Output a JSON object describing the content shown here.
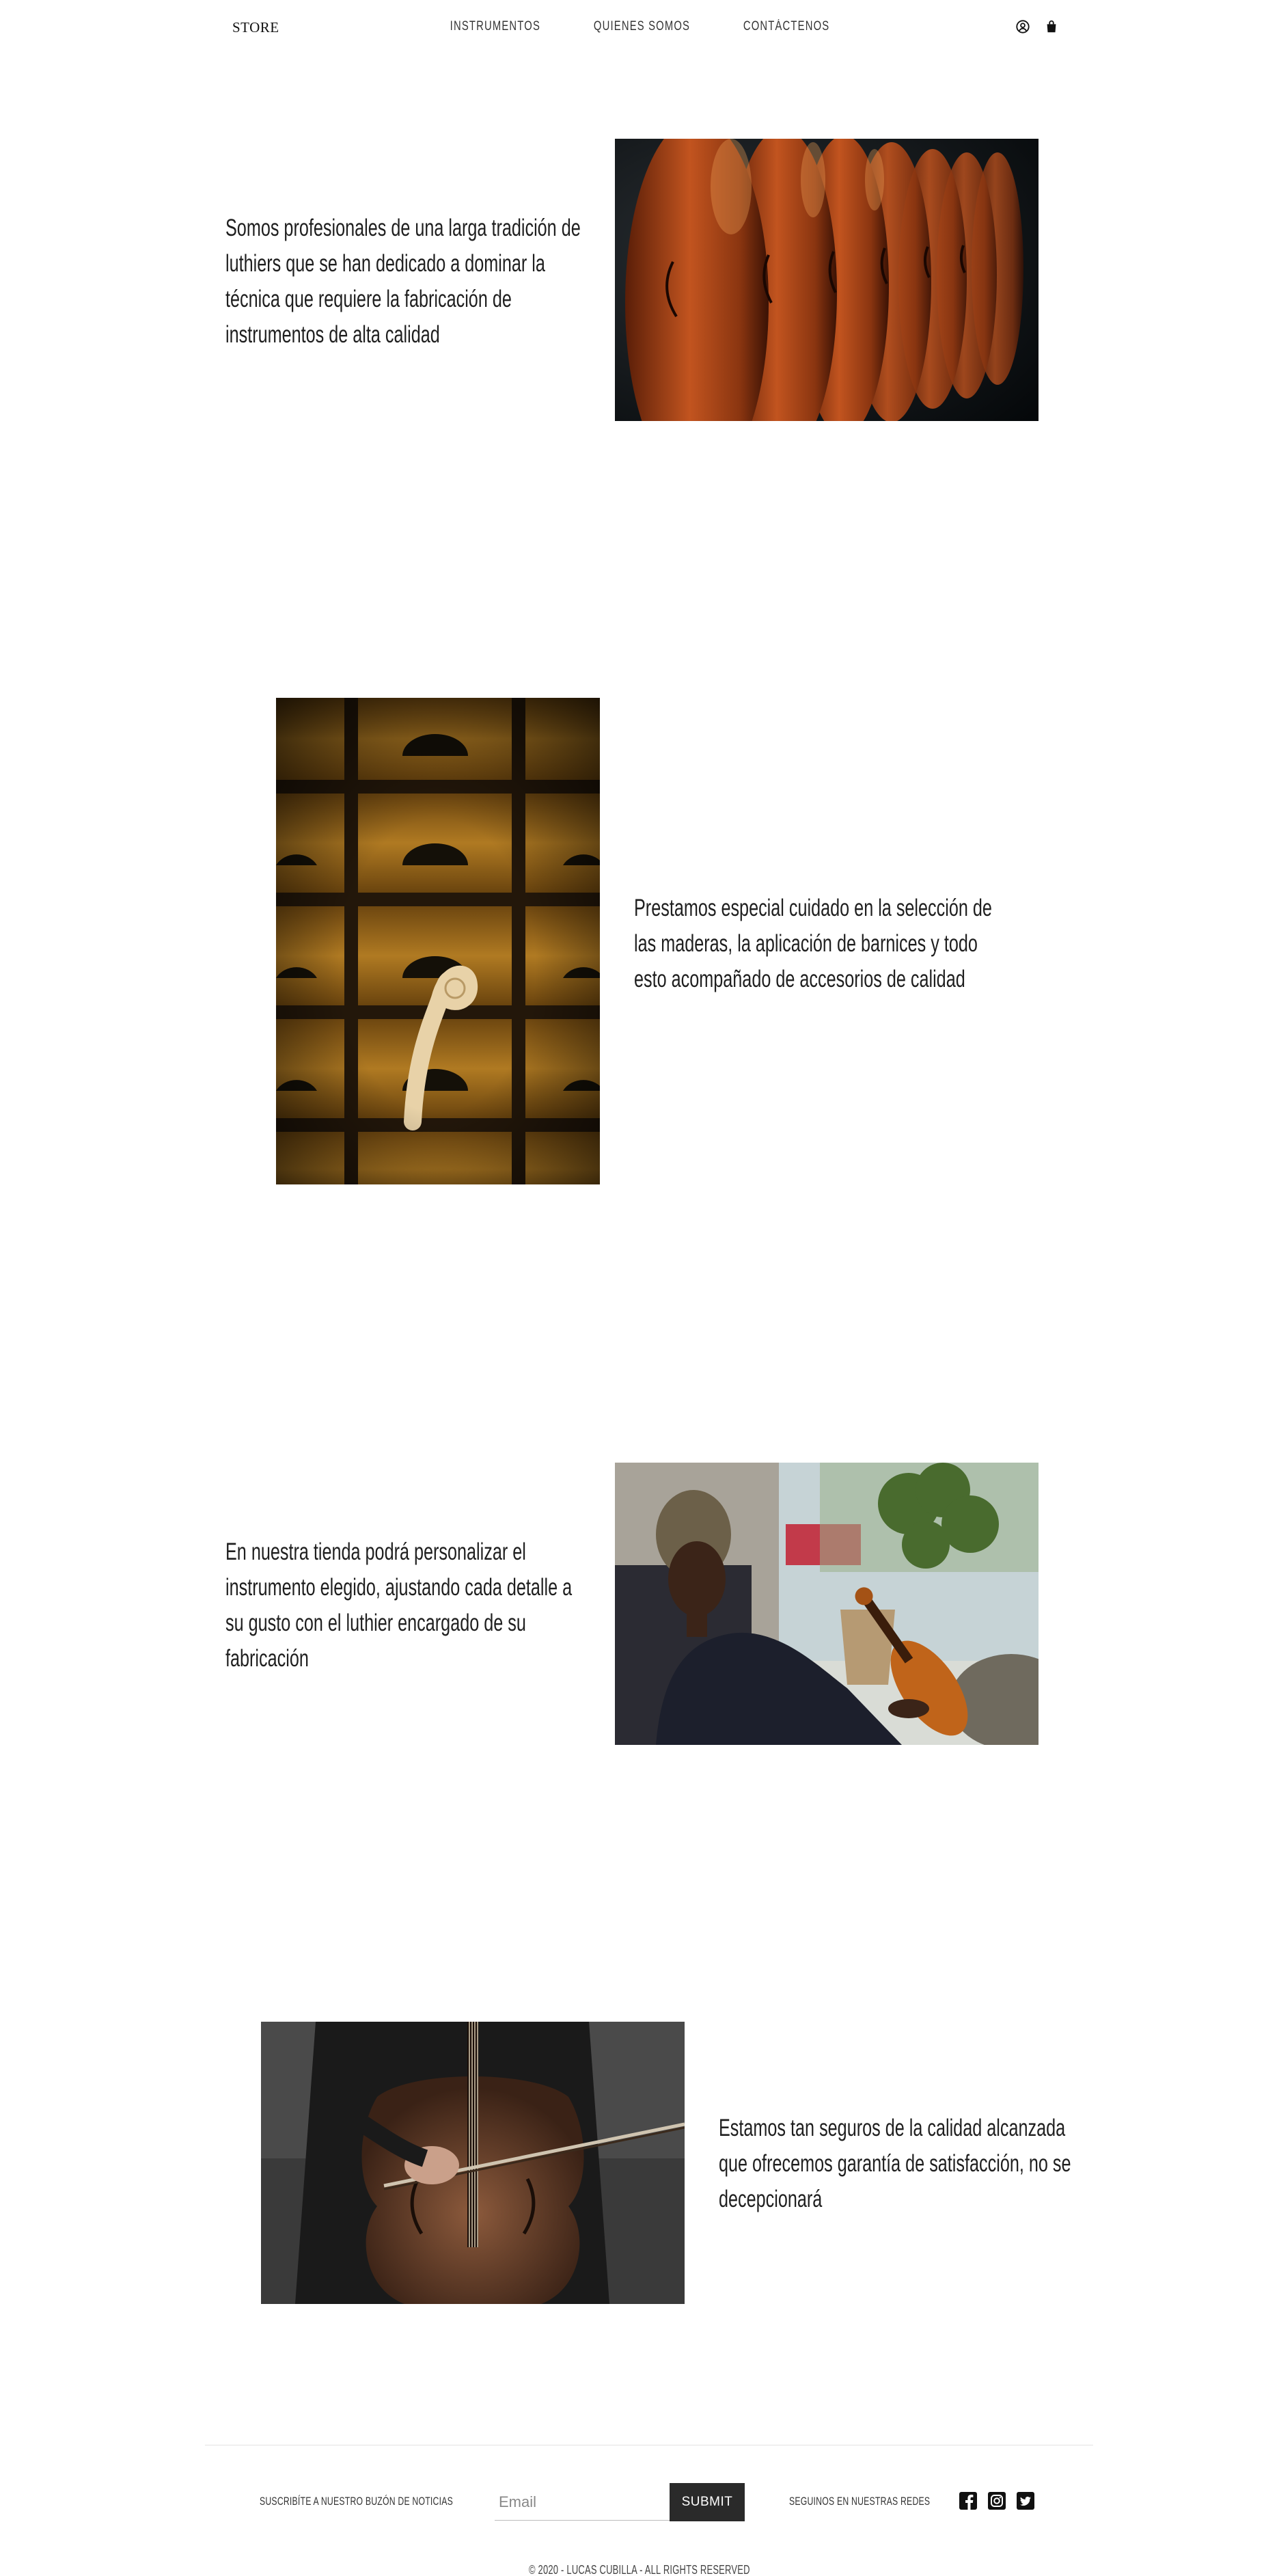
{
  "header": {
    "brand": "STORE",
    "nav": [
      "INSTRUMENTOS",
      "QUIENES SOMOS",
      "CONTÁCTENOS"
    ],
    "icons": [
      "user-icon",
      "shopping-bag-icon"
    ]
  },
  "features": [
    {
      "text": "Somos profesionales de una larga tradición de luthiers que se han dedicado a dominar la técnica que requiere la fabricación de instrumentos de alta calidad",
      "image": "violins-hanging"
    },
    {
      "text": "Prestamos especial cuidado en la selección de las maderas, la aplicación de barnices y todo esto acompañado de accesorios de calidad",
      "image": "wooden-drawers-scroll"
    },
    {
      "text": "En nuestra tienda podrá personalizar el instrumento elegido, ajustando cada detalle a su gusto con el luthier encargado de su fabricación",
      "image": "woman-playing-violin"
    },
    {
      "text": "Estamos tan seguros de la calidad alcanzada que ofrecemos garantía de satisfacción, no se decepcionará",
      "image": "cellist-playing"
    }
  ],
  "footer": {
    "newsletter_label": "SUSCRIBÍTE A NUESTRO BUZÓN DE NOTICIAS",
    "email_placeholder": "Email",
    "submit_label": "SUBMIT",
    "social_label": "SEGUINOS EN NUESTRAS REDES",
    "social_icons": [
      "facebook-icon",
      "instagram-icon",
      "twitter-icon"
    ],
    "copyright": "© 2020 - LUCAS CUBILLA - ALL RIGHTS RESERVED"
  },
  "colors": {
    "text": "#1f1f1f",
    "button": "#2a2a2a",
    "background": "#ffffff"
  }
}
